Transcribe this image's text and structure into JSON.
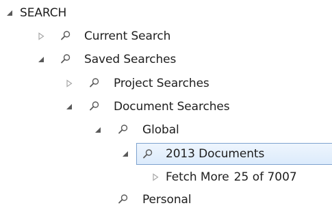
{
  "colors": {
    "expander_open": "#595959",
    "expander_closed": "#a6a6a6",
    "icon": "#595959",
    "selection_fill": "#dcebfc",
    "selection_border": "#7da2ce"
  },
  "tree": {
    "root": {
      "label": "SEARCH",
      "expander": "expanded-triangle-icon"
    },
    "current_search": {
      "label": "Current Search",
      "expander": "collapsed-triangle-icon",
      "icon": "search-icon"
    },
    "saved_searches": {
      "label": "Saved Searches",
      "expander": "expanded-triangle-icon",
      "icon": "search-icon"
    },
    "project_searches": {
      "label": "Project Searches",
      "expander": "collapsed-triangle-icon",
      "icon": "search-icon"
    },
    "document_searches": {
      "label": "Document Searches",
      "expander": "expanded-triangle-icon",
      "icon": "search-icon"
    },
    "global": {
      "label": "Global",
      "expander": "expanded-triangle-icon",
      "icon": "search-icon"
    },
    "documents_2013": {
      "label": "2013 Documents",
      "expander": "expanded-triangle-icon",
      "icon": "search-icon",
      "selected": true
    },
    "fetch_more": {
      "label": "Fetch More",
      "count": "25 of 7007",
      "expander": "collapsed-triangle-icon"
    },
    "personal": {
      "label": "Personal",
      "icon": "search-icon"
    }
  }
}
